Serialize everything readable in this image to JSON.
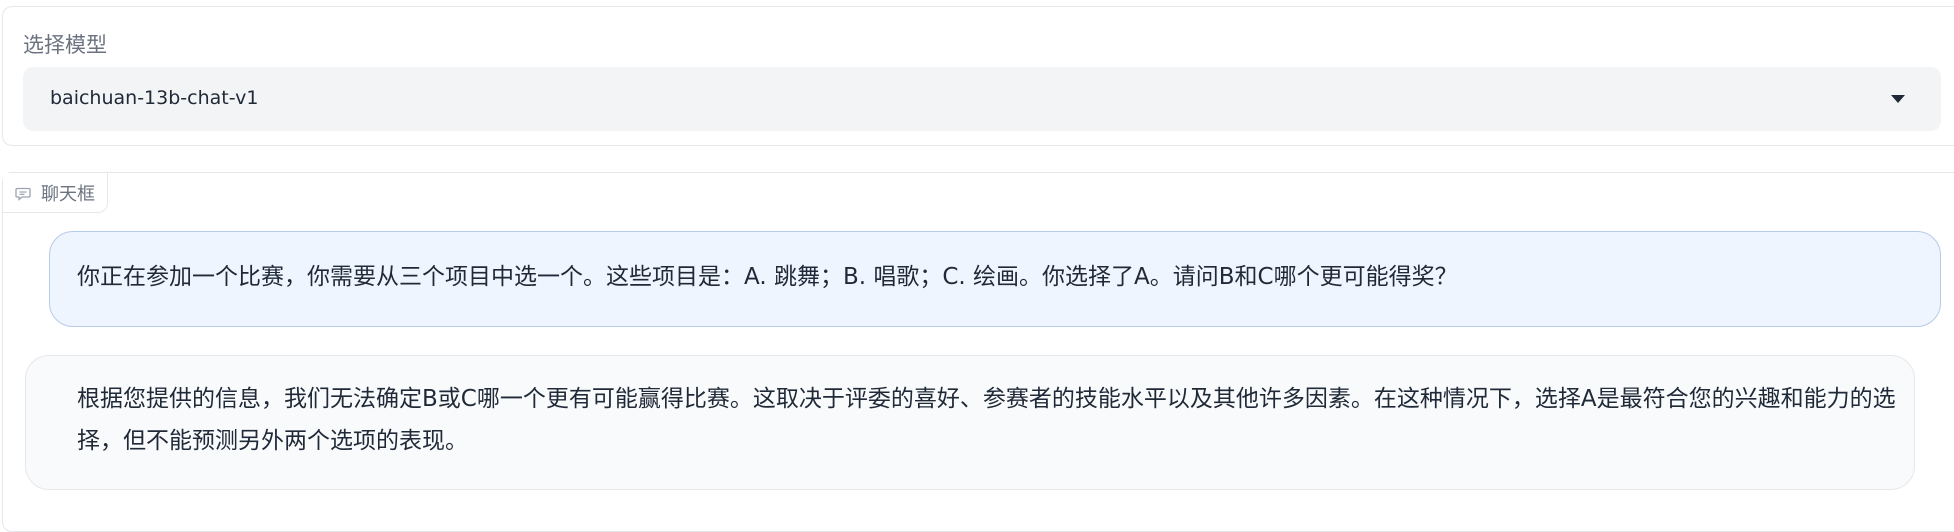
{
  "model_selector": {
    "label": "选择模型",
    "selected_value": "baichuan-13b-chat-v1"
  },
  "chat": {
    "tab_label": "聊天框",
    "tab_icon": "chat-bubble-icon",
    "messages": [
      {
        "role": "user",
        "text": "你正在参加一个比赛，你需要从三个项目中选一个。这些项目是：A. 跳舞；B. 唱歌；C. 绘画。你选择了A。请问B和C哪个更可能得奖？"
      },
      {
        "role": "bot",
        "text": "根据您提供的信息，我们无法确定B或C哪一个更有可能赢得比赛。这取决于评委的喜好、参赛者的技能水平以及其他许多因素。在这种情况下，选择A是最符合您的兴趣和能力的选择，但不能预测另外两个选项的表现。"
      }
    ]
  },
  "colors": {
    "user_bubble": "#eef5fe",
    "user_bubble_border": "#b6cbe8",
    "bot_bubble": "#f9fafb",
    "select_bg": "#f3f4f6"
  }
}
